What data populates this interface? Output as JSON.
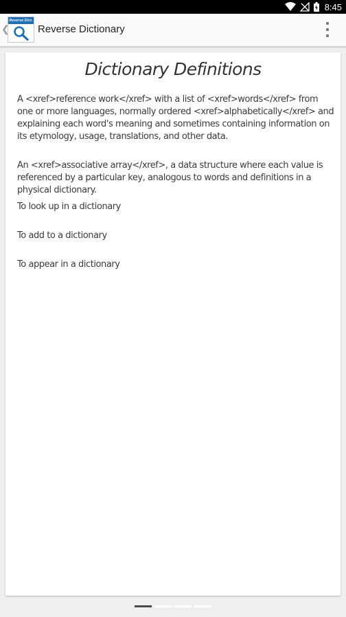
{
  "status_bar": {
    "time": "8:45",
    "icons": [
      "wifi-icon",
      "no-signal-icon",
      "battery-icon"
    ]
  },
  "app_bar": {
    "title": "Reverse Dictionary",
    "logo_text": "Reverse Dict.",
    "icons": [
      "back-chevron-icon",
      "magnifier-icon",
      "overflow-menu-icon"
    ]
  },
  "card": {
    "title": "Dictionary Definitions",
    "definitions": [
      "A <xref>reference work</xref> with a list of <xref>words</xref> from one or more languages, normally ordered <xref>alphabetically</xref> and explaining each word's meaning and sometimes containing information on its etymology, usage, translations, and other data.",
      "An <xref>associative array</xref>, a data structure where each value is referenced by a particular key, analogous to words and definitions in a physical dictionary.",
      "To look up in a dictionary",
      "To add to a dictionary",
      "To appear in a dictionary"
    ]
  },
  "pager": {
    "page_count": 4,
    "active_page": 1
  },
  "colors": {
    "status_bar": "#000000",
    "app_bar": "#fafafa",
    "background": "#efefef",
    "logo_band": "#1f6fb4"
  }
}
